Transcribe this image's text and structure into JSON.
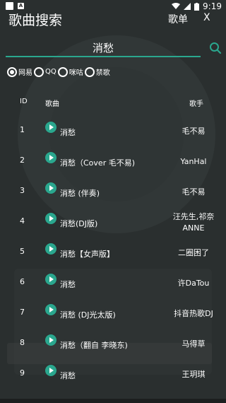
{
  "status": {
    "time": "9:19",
    "badge": "A"
  },
  "header": {
    "title": "歌曲搜索",
    "menu_song": "歌单",
    "menu_close": "X"
  },
  "search": {
    "value": "消愁"
  },
  "sources": [
    {
      "label": "网易",
      "selected": true
    },
    {
      "label": "QQ",
      "selected": false
    },
    {
      "label": "咪咕",
      "selected": false
    },
    {
      "label": "禁歌",
      "selected": false
    }
  ],
  "table": {
    "headers": {
      "id": "ID",
      "song": "歌曲",
      "artist": "歌手"
    },
    "rows": [
      {
        "id": "1",
        "song": "消愁",
        "artist": "毛不易"
      },
      {
        "id": "2",
        "song": "消愁（Cover 毛不易)",
        "artist": "YanHal"
      },
      {
        "id": "3",
        "song": "消愁 (伴奏)",
        "artist": "毛不易"
      },
      {
        "id": "4",
        "song": "消愁(DJ版)",
        "artist": "汪先生,祁奈ANNE"
      },
      {
        "id": "5",
        "song": "消愁【女声版】",
        "artist": "二圈困了"
      },
      {
        "id": "6",
        "song": "消愁",
        "artist": "许DaTou"
      },
      {
        "id": "7",
        "song": "消愁 (DJ光太版)",
        "artist": "抖音热歌DJ"
      },
      {
        "id": "8",
        "song": "消愁（翻自 李晓东)",
        "artist": "马得草"
      },
      {
        "id": "9",
        "song": "消愁",
        "artist": "王玥琪"
      }
    ]
  },
  "colors": {
    "accent": "#2aa78e",
    "background": "#2a2f2f"
  }
}
